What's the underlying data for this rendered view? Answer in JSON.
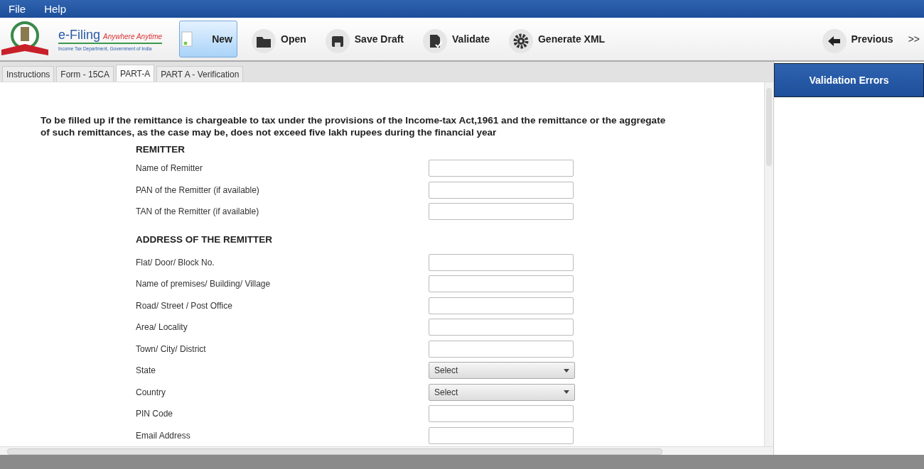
{
  "menu": [
    "File",
    "Help"
  ],
  "logo": {
    "title": "e-Filing",
    "tagline": "Anywhere Anytime",
    "subtitle": "Income Tax Department, Government of India"
  },
  "toolbar": [
    {
      "label": "New",
      "kind": "new",
      "selected": true
    },
    {
      "label": "Open",
      "kind": "open",
      "selected": false
    },
    {
      "label": "Save Draft",
      "kind": "save",
      "selected": false
    },
    {
      "label": "Validate",
      "kind": "validate",
      "selected": false
    },
    {
      "label": "Generate XML",
      "kind": "xml",
      "selected": false
    },
    {
      "label": "Previous",
      "kind": "previous",
      "selected": false
    }
  ],
  "more": ">>",
  "tabs": [
    {
      "label": "Instructions",
      "selected": false
    },
    {
      "label": "Form - 15CA",
      "selected": false
    },
    {
      "label": "PART-A",
      "selected": true
    },
    {
      "label": "PART A - Verification",
      "selected": false
    }
  ],
  "intro": "To be filled up if the remittance is chargeable to tax under the provisions of the Income-tax Act,1961 and the remittance or the aggregate of such remittances, as the case may be, does not exceed five lakh rupees during the financial year",
  "sections": [
    {
      "heading": "REMITTER",
      "fields": [
        {
          "label": "Name of Remitter",
          "kind": "text"
        },
        {
          "label": "PAN of the Remitter (if available)",
          "kind": "text"
        },
        {
          "label": "TAN of the Remitter (if available)",
          "kind": "text"
        }
      ]
    },
    {
      "heading": "ADDRESS OF THE REMITTER",
      "fields": [
        {
          "label": "Flat/ Door/ Block No.",
          "kind": "text"
        },
        {
          "label": "Name of premises/ Building/ Village",
          "kind": "text"
        },
        {
          "label": "Road/ Street / Post Office",
          "kind": "text"
        },
        {
          "label": "Area/ Locality",
          "kind": "text"
        },
        {
          "label": "Town/ City/ District",
          "kind": "text"
        },
        {
          "label": "State",
          "kind": "select",
          "value": "Select"
        },
        {
          "label": "Country",
          "kind": "select",
          "value": "Select"
        },
        {
          "label": "PIN Code",
          "kind": "text"
        },
        {
          "label": "Email Address",
          "kind": "text"
        }
      ]
    }
  ],
  "side_panel": {
    "title": "Validation Errors"
  }
}
